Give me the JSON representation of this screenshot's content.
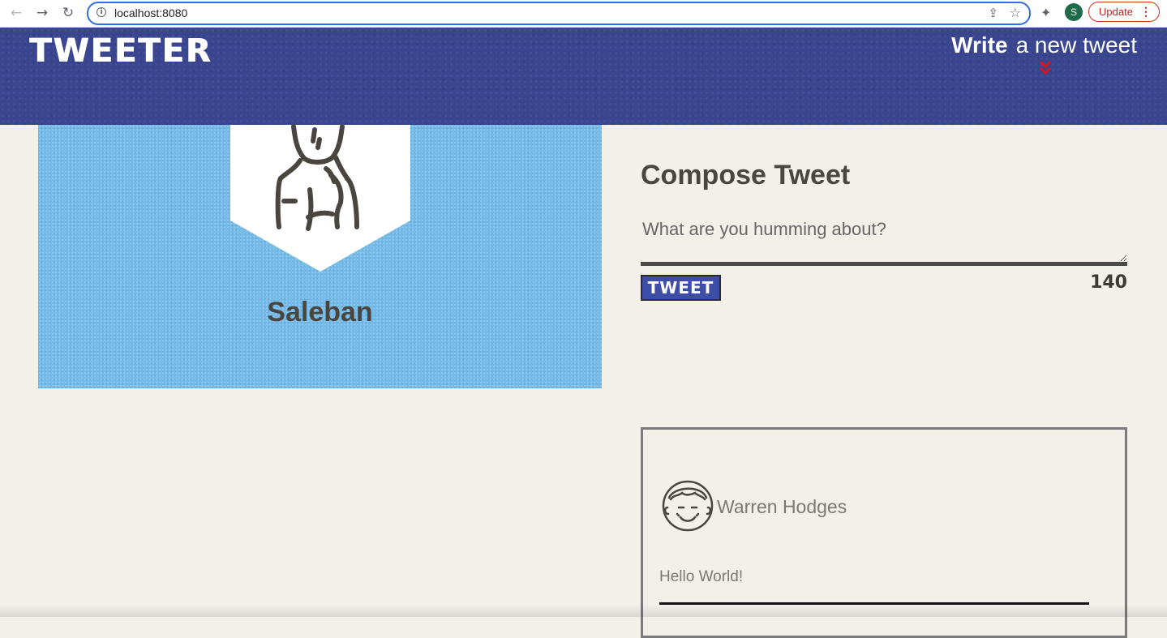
{
  "browser": {
    "url": "localhost:8080",
    "profile_initial": "S",
    "update_label": "Update",
    "icons": [
      "back-arrow-icon",
      "forward-arrow-icon",
      "reload-icon",
      "info-icon",
      "share-icon",
      "star-icon",
      "extensions-icon",
      "kebab-menu-icon"
    ]
  },
  "header": {
    "brand": "TWEETER",
    "write_bold": "Write",
    "write_rest": "a new tweet",
    "chevron_color": "#d7141a"
  },
  "profile": {
    "name": "Saleban",
    "panel_color": "#74bbe8"
  },
  "compose": {
    "title": "Compose Tweet",
    "placeholder": "What are you humming about?",
    "button_label": "TWEET",
    "counter": "140"
  },
  "tweets": [
    {
      "author": "Warren Hodges",
      "body": "Hello World!"
    }
  ],
  "colors": {
    "header_bg": "#3a4590",
    "page_bg": "#f3f0ea",
    "button_bg": "#3e4ea6",
    "text_dark": "#4a463f"
  }
}
